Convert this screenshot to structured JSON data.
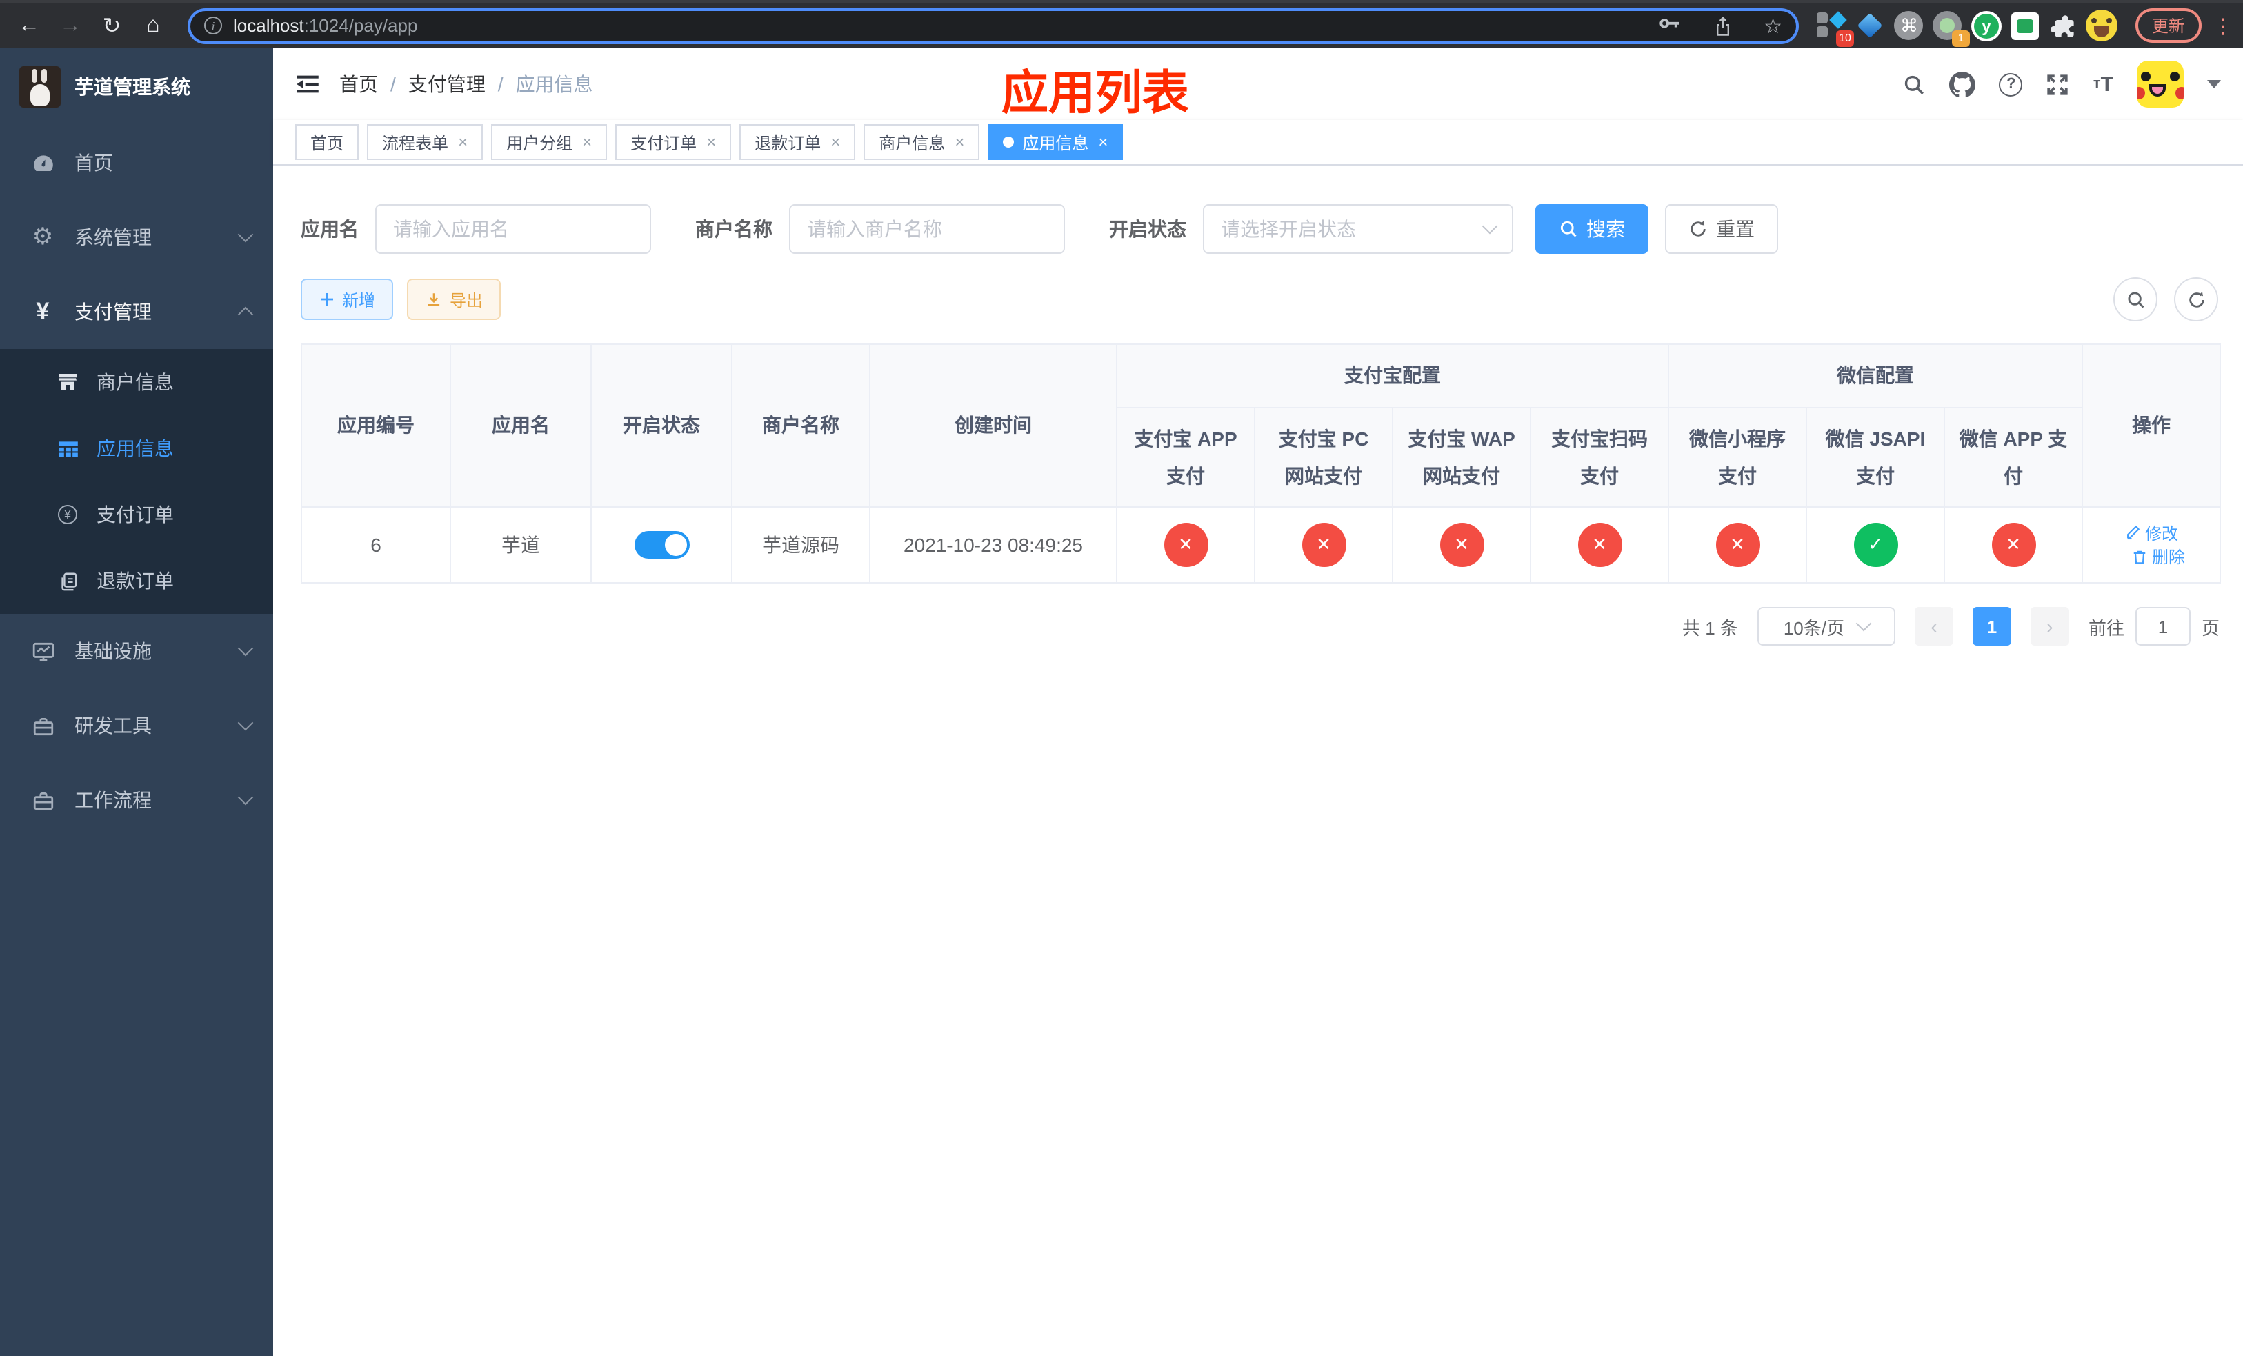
{
  "glyphs": {
    "back": "←",
    "forward": "→",
    "reload": "↻",
    "home": "⌂",
    "star": "☆",
    "command": "⌘",
    "kebab": "⋮",
    "close": "×",
    "cross": "✕",
    "check": "✓",
    "gear": "⚙",
    "yen": "¥",
    "prev": "‹",
    "next": "›",
    "slash": "/",
    "plus": "＋",
    "question": "?",
    "info": "i",
    "t_small": "т",
    "t_big": "T"
  },
  "browser": {
    "url_host": "localhost",
    "url_rest": ":1024/pay/app",
    "update_label": "更新",
    "ext_badge_a": "10",
    "ext_badge_b": "1",
    "ext_y_letter": "y"
  },
  "sidebar": {
    "app_title": "芋道管理系统",
    "items": [
      {
        "label": "首页",
        "expandable": false
      },
      {
        "label": "系统管理",
        "expandable": true,
        "expanded": false
      },
      {
        "label": "支付管理",
        "expandable": true,
        "expanded": true
      },
      {
        "label": "基础设施",
        "expandable": true,
        "expanded": false
      },
      {
        "label": "研发工具",
        "expandable": true,
        "expanded": false
      },
      {
        "label": "工作流程",
        "expandable": true,
        "expanded": false
      }
    ],
    "submenu": [
      {
        "label": "商户信息",
        "active": false
      },
      {
        "label": "应用信息",
        "active": true
      },
      {
        "label": "支付订单",
        "active": false
      },
      {
        "label": "退款订单",
        "active": false
      }
    ]
  },
  "header": {
    "breadcrumb": [
      "首页",
      "支付管理",
      "应用信息"
    ],
    "overlay_title": "应用列表"
  },
  "tabs": [
    {
      "label": "首页",
      "closable": false,
      "active": false
    },
    {
      "label": "流程表单",
      "closable": true,
      "active": false
    },
    {
      "label": "用户分组",
      "closable": true,
      "active": false
    },
    {
      "label": "支付订单",
      "closable": true,
      "active": false
    },
    {
      "label": "退款订单",
      "closable": true,
      "active": false
    },
    {
      "label": "商户信息",
      "closable": true,
      "active": false
    },
    {
      "label": "应用信息",
      "closable": true,
      "active": true
    }
  ],
  "filters": {
    "app_name_label": "应用名",
    "app_name_placeholder": "请输入应用名",
    "merchant_label": "商户名称",
    "merchant_placeholder": "请输入商户名称",
    "status_label": "开启状态",
    "status_placeholder": "请选择开启状态",
    "search_label": "搜索",
    "reset_label": "重置"
  },
  "toolbar": {
    "add_label": "新增",
    "export_label": "导出"
  },
  "table": {
    "group_alipay": "支付宝配置",
    "group_wechat": "微信配置",
    "columns": [
      "应用编号",
      "应用名",
      "开启状态",
      "商户名称",
      "创建时间",
      "支付宝 APP 支付",
      "支付宝 PC 网站支付",
      "支付宝 WAP 网站支付",
      "支付宝扫码支付",
      "微信小程序支付",
      "微信 JSAPI 支付",
      "微信 APP 支付",
      "操作"
    ],
    "rows": [
      {
        "id": "6",
        "name": "芋道",
        "enabled": true,
        "merchant": "芋道源码",
        "created": "2021-10-23 08:49:25",
        "statuses": [
          "no",
          "no",
          "no",
          "no",
          "no",
          "yes",
          "no"
        ]
      }
    ],
    "edit_label": "修改",
    "delete_label": "删除"
  },
  "pagination": {
    "total_label": "共 1 条",
    "page_size_label": "10条/页",
    "current_page": "1",
    "goto_label": "前往",
    "goto_value": "1",
    "page_unit": "页"
  },
  "colors": {
    "accent": "#409eff",
    "danger": "#f34d43",
    "success": "#0fbf61",
    "warning": "#e6a23c",
    "overlay_title": "#fe2b00",
    "sidebar_bg": "#304156",
    "submenu_bg": "#1f2d3d"
  }
}
